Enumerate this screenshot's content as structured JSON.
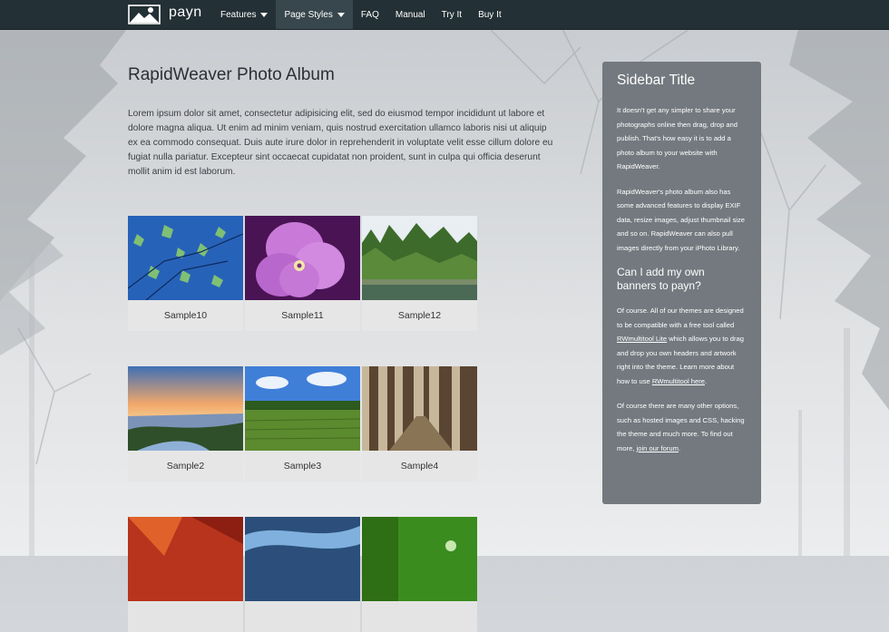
{
  "nav": {
    "brand": "payn",
    "items": [
      {
        "label": "Features",
        "dropdown": true,
        "active": false
      },
      {
        "label": "Page Styles",
        "dropdown": true,
        "active": true
      },
      {
        "label": "FAQ",
        "dropdown": false,
        "active": false
      },
      {
        "label": "Manual",
        "dropdown": false,
        "active": false
      },
      {
        "label": "Try It",
        "dropdown": false,
        "active": false
      },
      {
        "label": "Buy It",
        "dropdown": false,
        "active": false
      }
    ]
  },
  "main": {
    "title": "RapidWeaver Photo Album",
    "intro": "Lorem ipsum dolor sit amet, consectetur adipisicing elit, sed do eiusmod tempor incididunt ut labore et dolore magna aliqua. Ut enim ad minim veniam, quis nostrud exercitation ullamco laboris nisi ut aliquip ex ea commodo consequat. Duis aute irure dolor in reprehenderit in voluptate velit esse cillum dolore eu fugiat nulla pariatur. Excepteur sint occaecat cupidatat non proident, sunt in culpa qui officia deserunt mollit anim id est laborum.",
    "thumbnails": [
      {
        "caption": "Sample10"
      },
      {
        "caption": "Sample11"
      },
      {
        "caption": "Sample12"
      },
      {
        "caption": "Sample2"
      },
      {
        "caption": "Sample3"
      },
      {
        "caption": "Sample4"
      }
    ]
  },
  "sidebar": {
    "title": "Sidebar Title",
    "p1": "It doesn't get any simpler to share your photographs online then drag, drop and publish. That's how easy it is to add a photo album to your website with RapidWeaver.",
    "p2": "RapidWeaver's photo album also has some advanced features to display EXIF data, resize images, adjust thumbnail size and so on. RapidWeaver can also pull images directly from your iPhoto Library.",
    "subtitle": "Can I add my own banners to payn?",
    "p3": {
      "a": "Of course. All of our themes are designed to be compatible with a free tool called ",
      "link1": "RWmultitool Lite",
      "b": " which allows you to drag and drop you own headers and artwork right into the theme. Learn more about how to use ",
      "link2": "RWmultitool here",
      "c": "."
    },
    "p4": {
      "a": "Of course there are many other options, such as hosted images and CSS, hacking the theme and much more. To find out more, ",
      "link": "join our forum",
      "b": "."
    }
  }
}
